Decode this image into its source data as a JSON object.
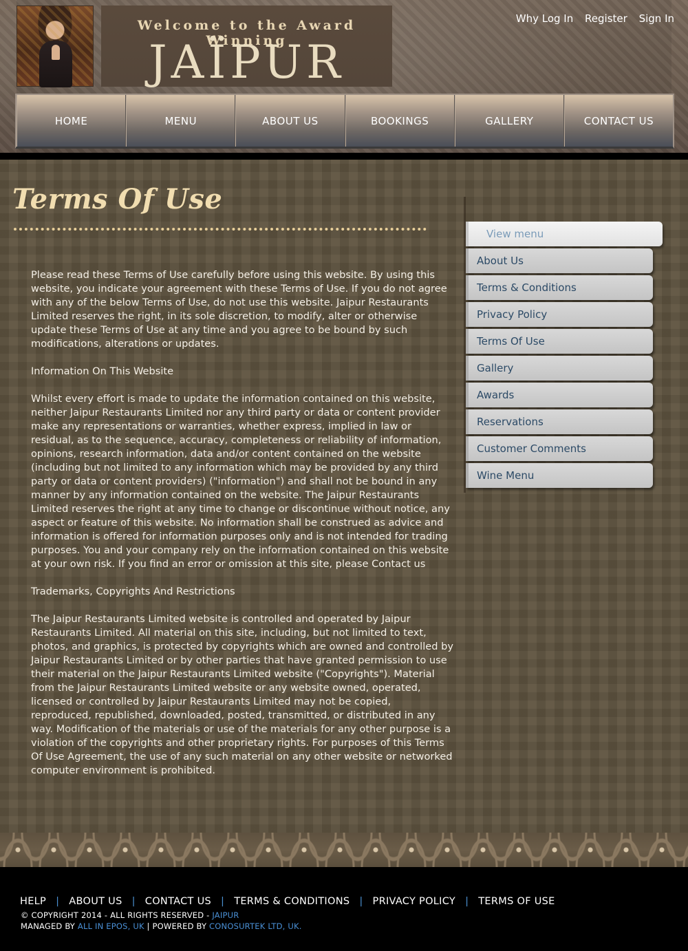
{
  "header": {
    "welcome_text": "Welcome to the Award Winning",
    "brand_name": "JAÏPUR",
    "top_links": [
      "Why Log In",
      "Register",
      "Sign In"
    ]
  },
  "nav": {
    "items": [
      "HOME",
      "MENU",
      "ABOUT US",
      "BOOKINGS",
      "GALLERY",
      "CONTACT US"
    ]
  },
  "page": {
    "title": "Terms Of Use",
    "paragraphs": [
      "Please read these Terms of Use carefully before using this website. By using this website, you indicate your agreement with these Terms of Use. If you do not agree with any of the below Terms of Use, do not use this website. Jaipur Restaurants Limited reserves the right, in its sole discretion, to modify, alter or otherwise update these Terms of Use at any time and you agree to be bound by such modifications, alterations or updates.",
      "Information On This Website",
      "Whilst every effort is made to update the information contained on this website, neither Jaipur Restaurants Limited nor any third party or data or content provider make any representations or warranties, whether express, implied in law or residual, as to the sequence, accuracy, completeness or reliability of information, opinions, research information, data and/or content contained on the website (including but not limited to any information which may be provided by any third party or data or content providers) (\"information\") and shall not be bound in any manner by any information contained on the website. The Jaipur Restaurants Limited reserves the right at any time to change or discontinue without notice, any aspect or feature of this website. No information shall be construed as advice and information is offered for information purposes only and is not intended for trading purposes. You and your company rely on the information contained on this website at your own risk. If you find an error or omission at this site, please Contact us",
      "Trademarks, Copyrights And Restrictions",
      "The Jaipur Restaurants Limited website is controlled and operated by Jaipur Restaurants Limited. All material on this site, including, but not limited to text, photos, and graphics, is protected by copyrights which are owned and controlled by Jaipur Restaurants Limited or by other parties that have granted permission to use their material on the Jaipur Restaurants Limited website (\"Copyrights\"). Material from the Jaipur Restaurants Limited website or any website owned, operated, licensed or controlled by Jaipur Restaurants Limited may not be copied, reproduced, republished, downloaded, posted, transmitted, or distributed in any way. Modification of the materials or use of the materials for any other purpose is a violation of the copyrights and other proprietary rights. For purposes of this Terms Of Use Agreement, the use of any such material on any other website or networked computer environment is prohibited."
    ]
  },
  "sidebar": {
    "view_menu": "View menu",
    "items": [
      "About Us",
      "Terms & Conditions",
      "Privacy Policy",
      "Terms Of Use",
      "Gallery",
      "Awards",
      "Reservations",
      "Customer Comments",
      "Wine Menu"
    ]
  },
  "footer": {
    "links": [
      "HELP",
      "ABOUT US",
      "CONTACT US",
      "TERMS & CONDITIONS",
      "PRIVACY POLICY",
      "TERMS OF USE"
    ],
    "separator": "|",
    "copyright_prefix": "© COPYRIGHT 2014 - ALL RIGHTS RESERVED - ",
    "copyright_link": "JAIPUR",
    "managed_prefix": "MANAGED BY ",
    "managed_link": "ALL IN EPOS, UK",
    "powered_prefix": " | POWERED BY ",
    "powered_link": "CONOSURTEK LTD, UK."
  },
  "colors": {
    "link_blue": "#4a90d6",
    "title_gold": "#f1ddb0",
    "sidebar_text": "#2c4a66"
  }
}
